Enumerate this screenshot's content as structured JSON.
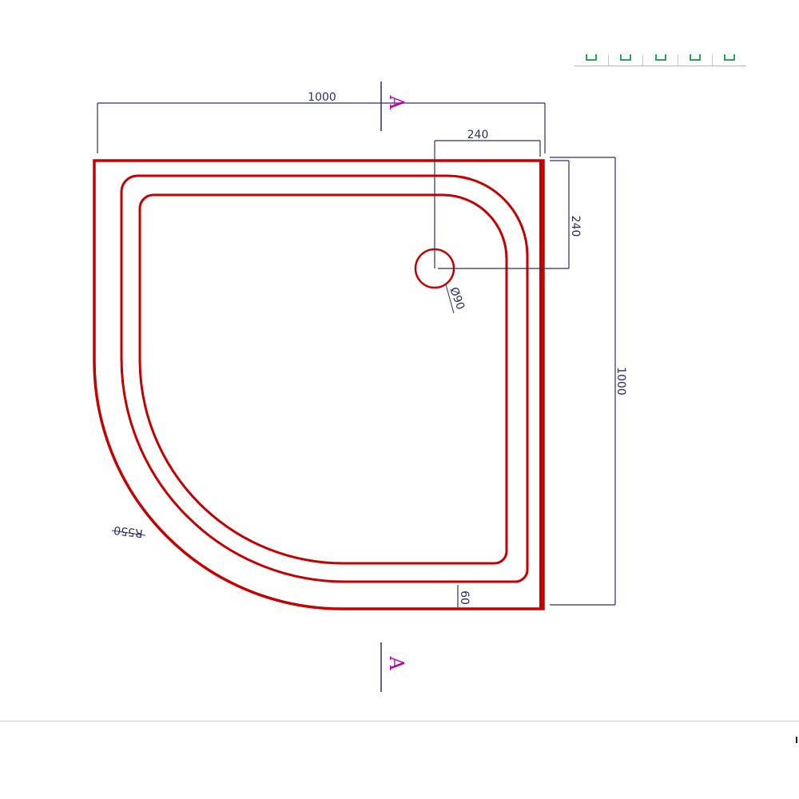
{
  "dimensions": {
    "overall_width": "1000",
    "overall_height": "1000",
    "drain_offset_x": "240",
    "drain_offset_y": "240",
    "drain_diameter": "Ø90",
    "corner_radius": "R550",
    "rim_width": "60"
  },
  "section_marks": {
    "top": "A",
    "bottom": "A"
  },
  "colors": {
    "tray_outline": "#c40000",
    "dimension_line": "#2b2f6b",
    "section_mark": "#b000b0",
    "toolbar_icon": "#2aa65a"
  },
  "toolbar": {
    "buttons": [
      "toolbar-icon-1",
      "toolbar-icon-2",
      "toolbar-icon-3",
      "toolbar-icon-4",
      "toolbar-icon-5"
    ]
  }
}
